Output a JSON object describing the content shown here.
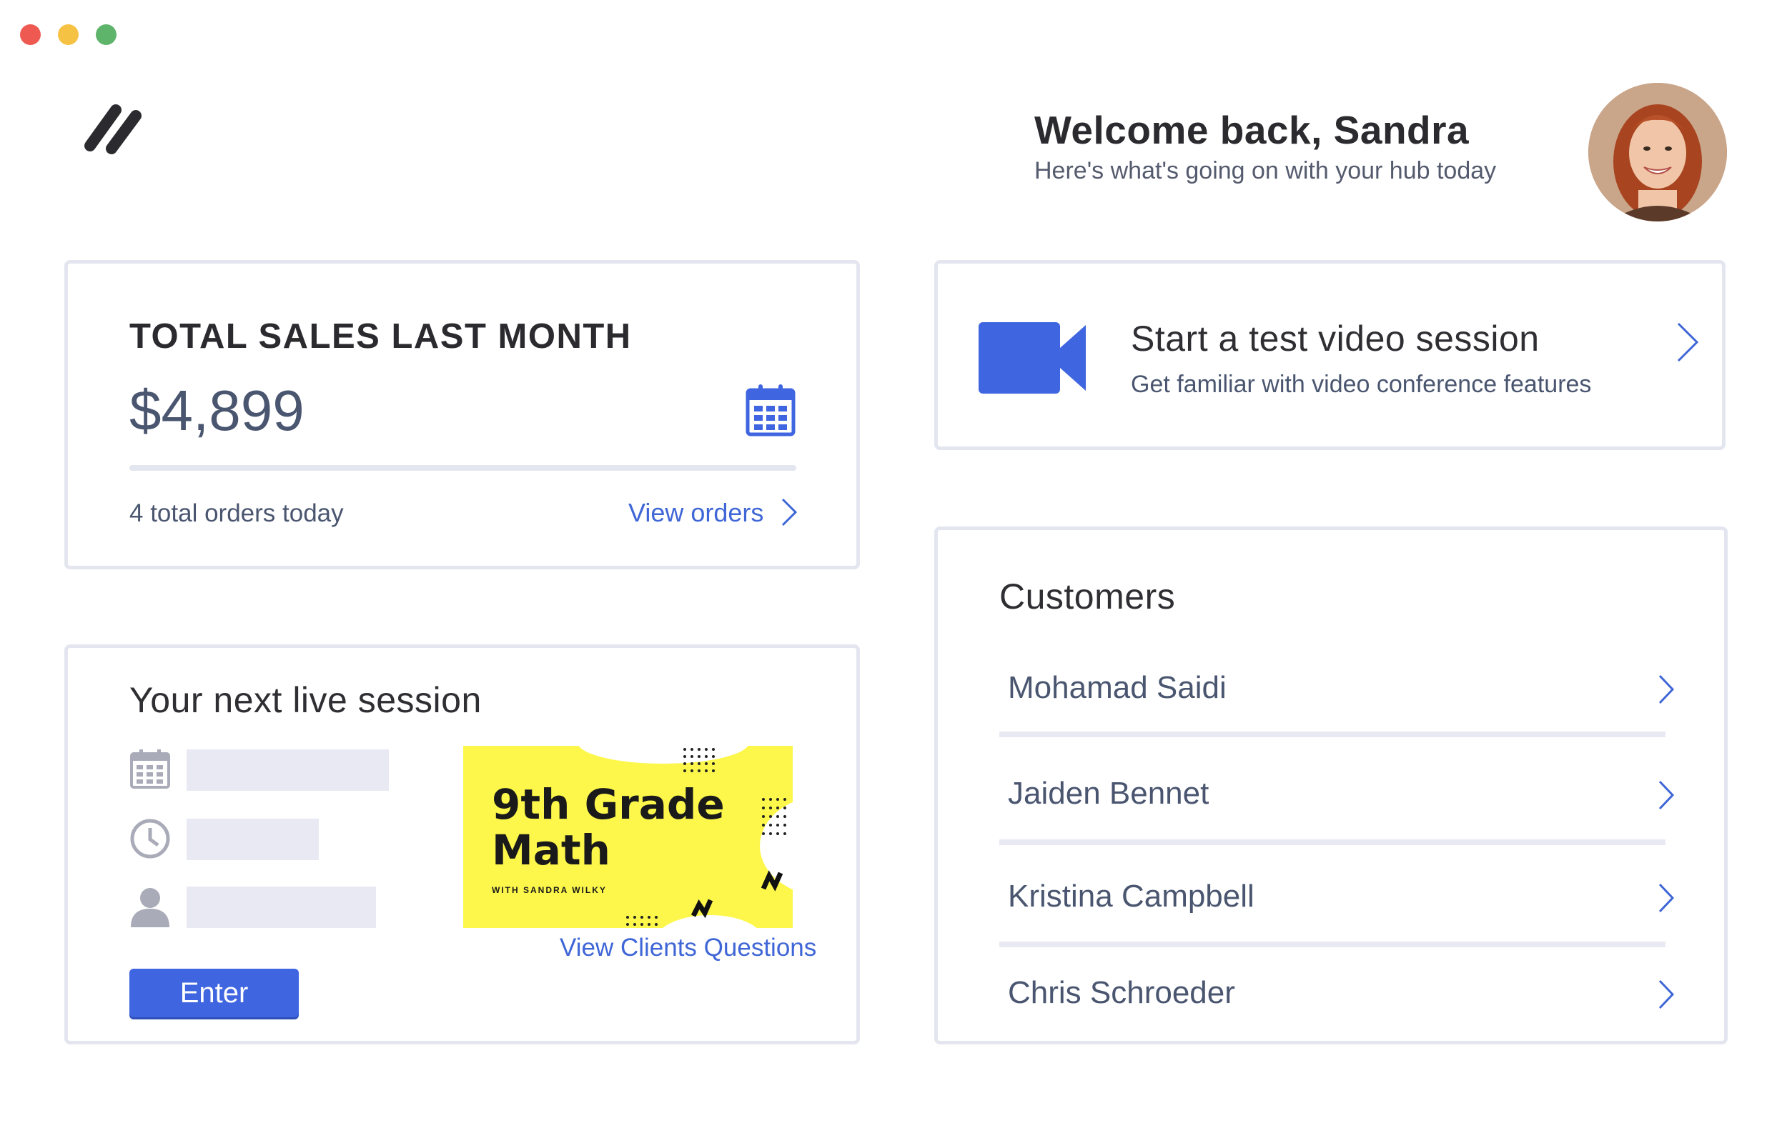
{
  "header": {
    "welcome_title": "Welcome back, Sandra",
    "welcome_subtitle": "Here's what's going on with your hub today"
  },
  "sales": {
    "title": "TOTAL SALES LAST MONTH",
    "amount": "$4,899",
    "orders_text": "4 total orders today",
    "view_orders_label": "View orders"
  },
  "live_session": {
    "title": "Your next live session",
    "enter_label": "Enter",
    "thumbnail_title_line1": "9th Grade",
    "thumbnail_title_line2": "Math",
    "thumbnail_subtitle": "WITH SANDRA WILKY",
    "view_questions_label": "View Clients Questions"
  },
  "video": {
    "title": "Start a test video session",
    "subtitle": "Get familiar with video conference features"
  },
  "customers": {
    "title": "Customers",
    "items": [
      {
        "name": "Mohamad Saidi"
      },
      {
        "name": "Jaiden Bennet"
      },
      {
        "name": "Kristina Campbell"
      },
      {
        "name": "Chris Schroeder"
      }
    ]
  },
  "colors": {
    "accent": "#3f66e0",
    "link": "#3f66d6",
    "thumbnail_bg": "#fcf74a",
    "border": "#e4e6ef"
  },
  "icons": [
    "logo-icon",
    "calendar-icon",
    "clock-icon",
    "user-icon",
    "video-camera-icon",
    "chevron-right-icon"
  ]
}
